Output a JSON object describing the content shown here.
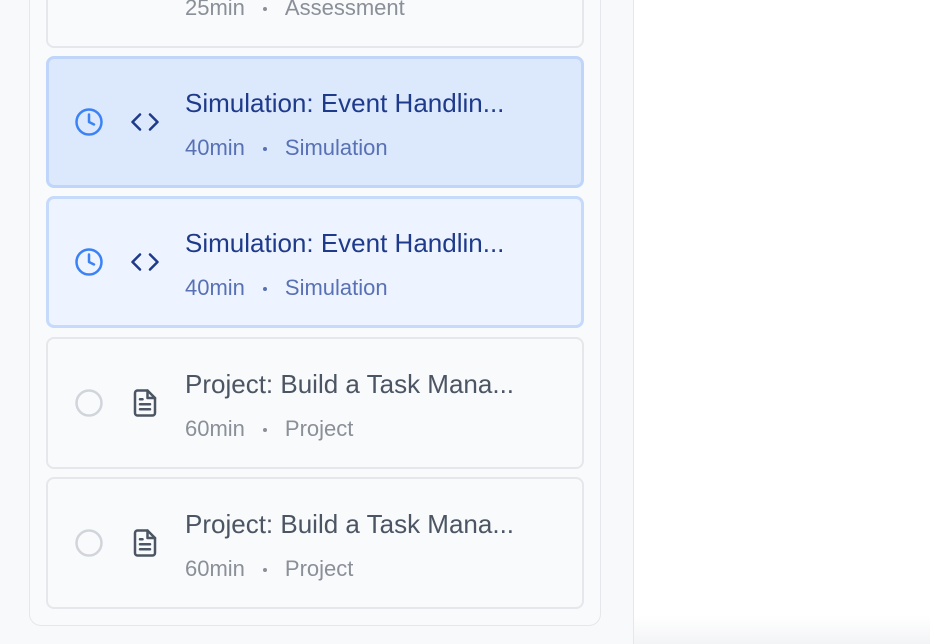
{
  "lessons": [
    {
      "title": "",
      "duration": "25min",
      "type": "Assessment",
      "state": "pending",
      "icon": "document-icon"
    },
    {
      "title": "Simulation: Event Handlin...",
      "duration": "40min",
      "type": "Simulation",
      "state": "active",
      "icon": "code-icon"
    },
    {
      "title": "Simulation: Event Handlin...",
      "duration": "40min",
      "type": "Simulation",
      "state": "current",
      "icon": "code-icon"
    },
    {
      "title": "Project: Build a Task Mana...",
      "duration": "60min",
      "type": "Project",
      "state": "pending",
      "icon": "document-icon"
    },
    {
      "title": "Project: Build a Task Mana...",
      "duration": "60min",
      "type": "Project",
      "state": "pending",
      "icon": "document-icon"
    }
  ],
  "colors": {
    "accent": "#3b82f6",
    "active_bg": "#dce8fc",
    "current_bg": "#eef4ff",
    "title_active": "#1e3a8a",
    "muted": "#8a8f98"
  }
}
